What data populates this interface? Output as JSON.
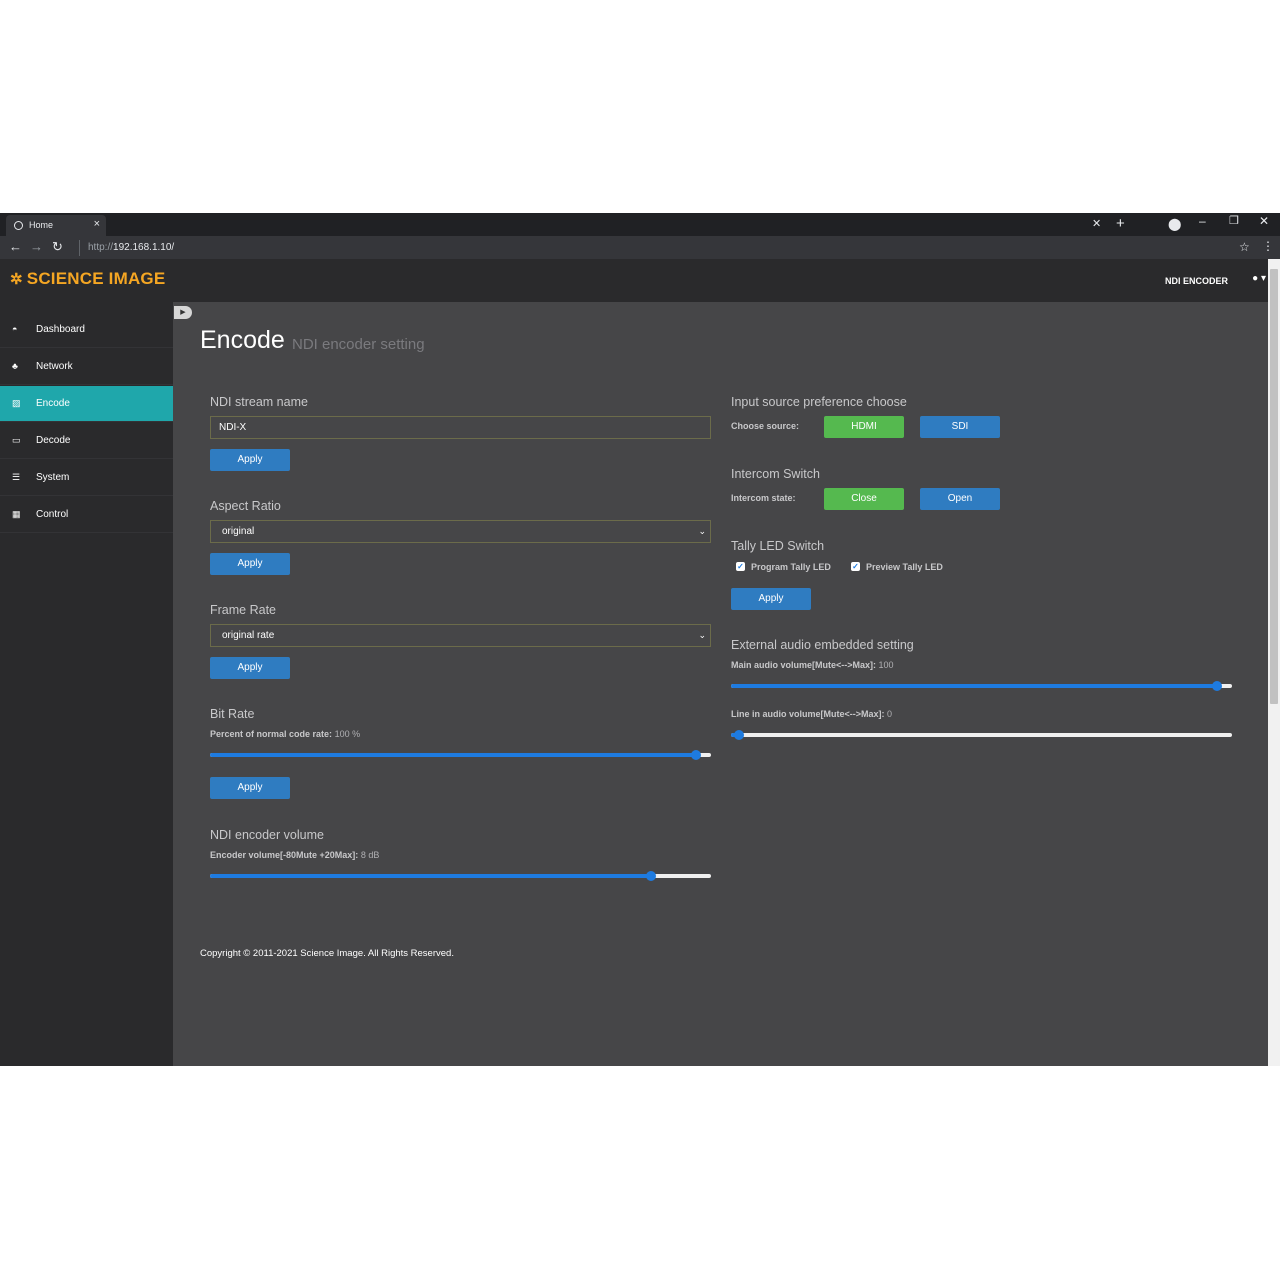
{
  "browser": {
    "tab_title": "Home",
    "tab_close": "×",
    "url_prefix": "http://",
    "url_host": "192.168.1.10/"
  },
  "header": {
    "logo_text": "SCIENCE IMAGE",
    "device_name": "NDI ENCODER"
  },
  "sidebar": {
    "items": [
      {
        "label": "Dashboard",
        "icon": "dashboard-icon"
      },
      {
        "label": "Network",
        "icon": "network-icon"
      },
      {
        "label": "Encode",
        "icon": "image-icon",
        "active": true
      },
      {
        "label": "Decode",
        "icon": "monitor-icon"
      },
      {
        "label": "System",
        "icon": "server-icon"
      },
      {
        "label": "Control",
        "icon": "table-icon"
      }
    ]
  },
  "page": {
    "title": "Encode",
    "subtitle": "NDI encoder setting"
  },
  "left": {
    "stream_name": {
      "title": "NDI stream name",
      "value": "NDI-X",
      "apply": "Apply"
    },
    "aspect_ratio": {
      "title": "Aspect Ratio",
      "value": "original",
      "apply": "Apply"
    },
    "frame_rate": {
      "title": "Frame Rate",
      "value": "original rate",
      "apply": "Apply"
    },
    "bit_rate": {
      "title": "Bit Rate",
      "label": "Percent of normal code rate:",
      "value_text": "100 %",
      "percent": 100,
      "apply": "Apply"
    },
    "volume": {
      "title": "NDI encoder volume",
      "label": "Encoder volume[-80Mute +20Max]:",
      "value_text": "8 dB",
      "value": 8,
      "min": -80,
      "max": 20
    }
  },
  "right": {
    "source": {
      "title": "Input source preference choose",
      "label": "Choose source:",
      "btn_hdmi": "HDMI",
      "btn_sdi": "SDI"
    },
    "intercom": {
      "title": "Intercom Switch",
      "label": "Intercom state:",
      "btn_close": "Close",
      "btn_open": "Open"
    },
    "tally": {
      "title": "Tally LED Switch",
      "program": "Program Tally LED",
      "preview": "Preview Tally LED",
      "program_checked": true,
      "preview_checked": true,
      "apply": "Apply"
    },
    "audio": {
      "title": "External audio embedded setting",
      "main_label": "Main audio volume[Mute<-->Max]:",
      "main_value_text": "100",
      "main_percent": 100,
      "line_label": "Line in audio volume[Mute<-->Max]:",
      "line_value_text": "0",
      "line_percent": 0
    }
  },
  "footer": {
    "copyright": "Copyright © 2011-2021 Science Image. All Rights Reserved."
  },
  "colors": {
    "accent_teal": "#1fa7ab",
    "logo_orange": "#f5a623",
    "button_blue": "#2f7cc1",
    "button_green": "#55b94f",
    "slider_blue": "#1e7be0"
  }
}
